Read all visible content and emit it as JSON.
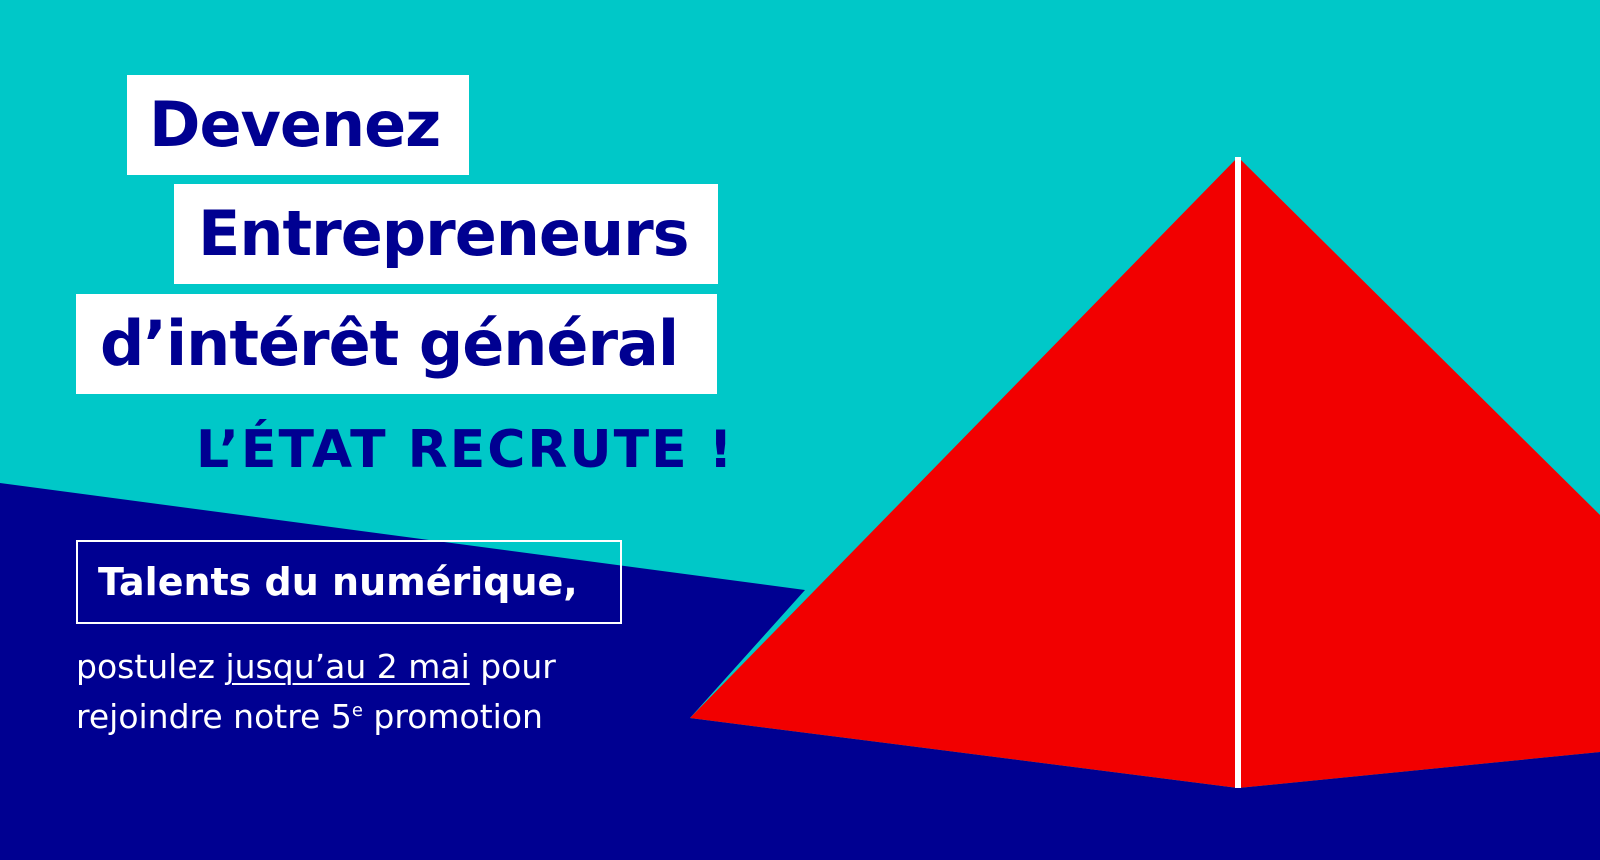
{
  "colors": {
    "teal": "#00c8c8",
    "navy": "#000091",
    "red": "#f20000",
    "white": "#ffffff"
  },
  "headline": {
    "line1": "Devenez",
    "line2": "Entrepreneurs",
    "line3": "d’intérêt général"
  },
  "tagline": "L’ÉTAT RECRUTE !",
  "talents": "Talents du numérique,",
  "cta": {
    "line1_prefix": "postulez ",
    "line1_link": "jusqu’au 2 mai",
    "line1_suffix": " pour",
    "line2_prefix": "rejoindre notre 5",
    "line2_sup": "e",
    "line2_suffix": " promotion"
  },
  "illustration": "pyramid-illustration"
}
